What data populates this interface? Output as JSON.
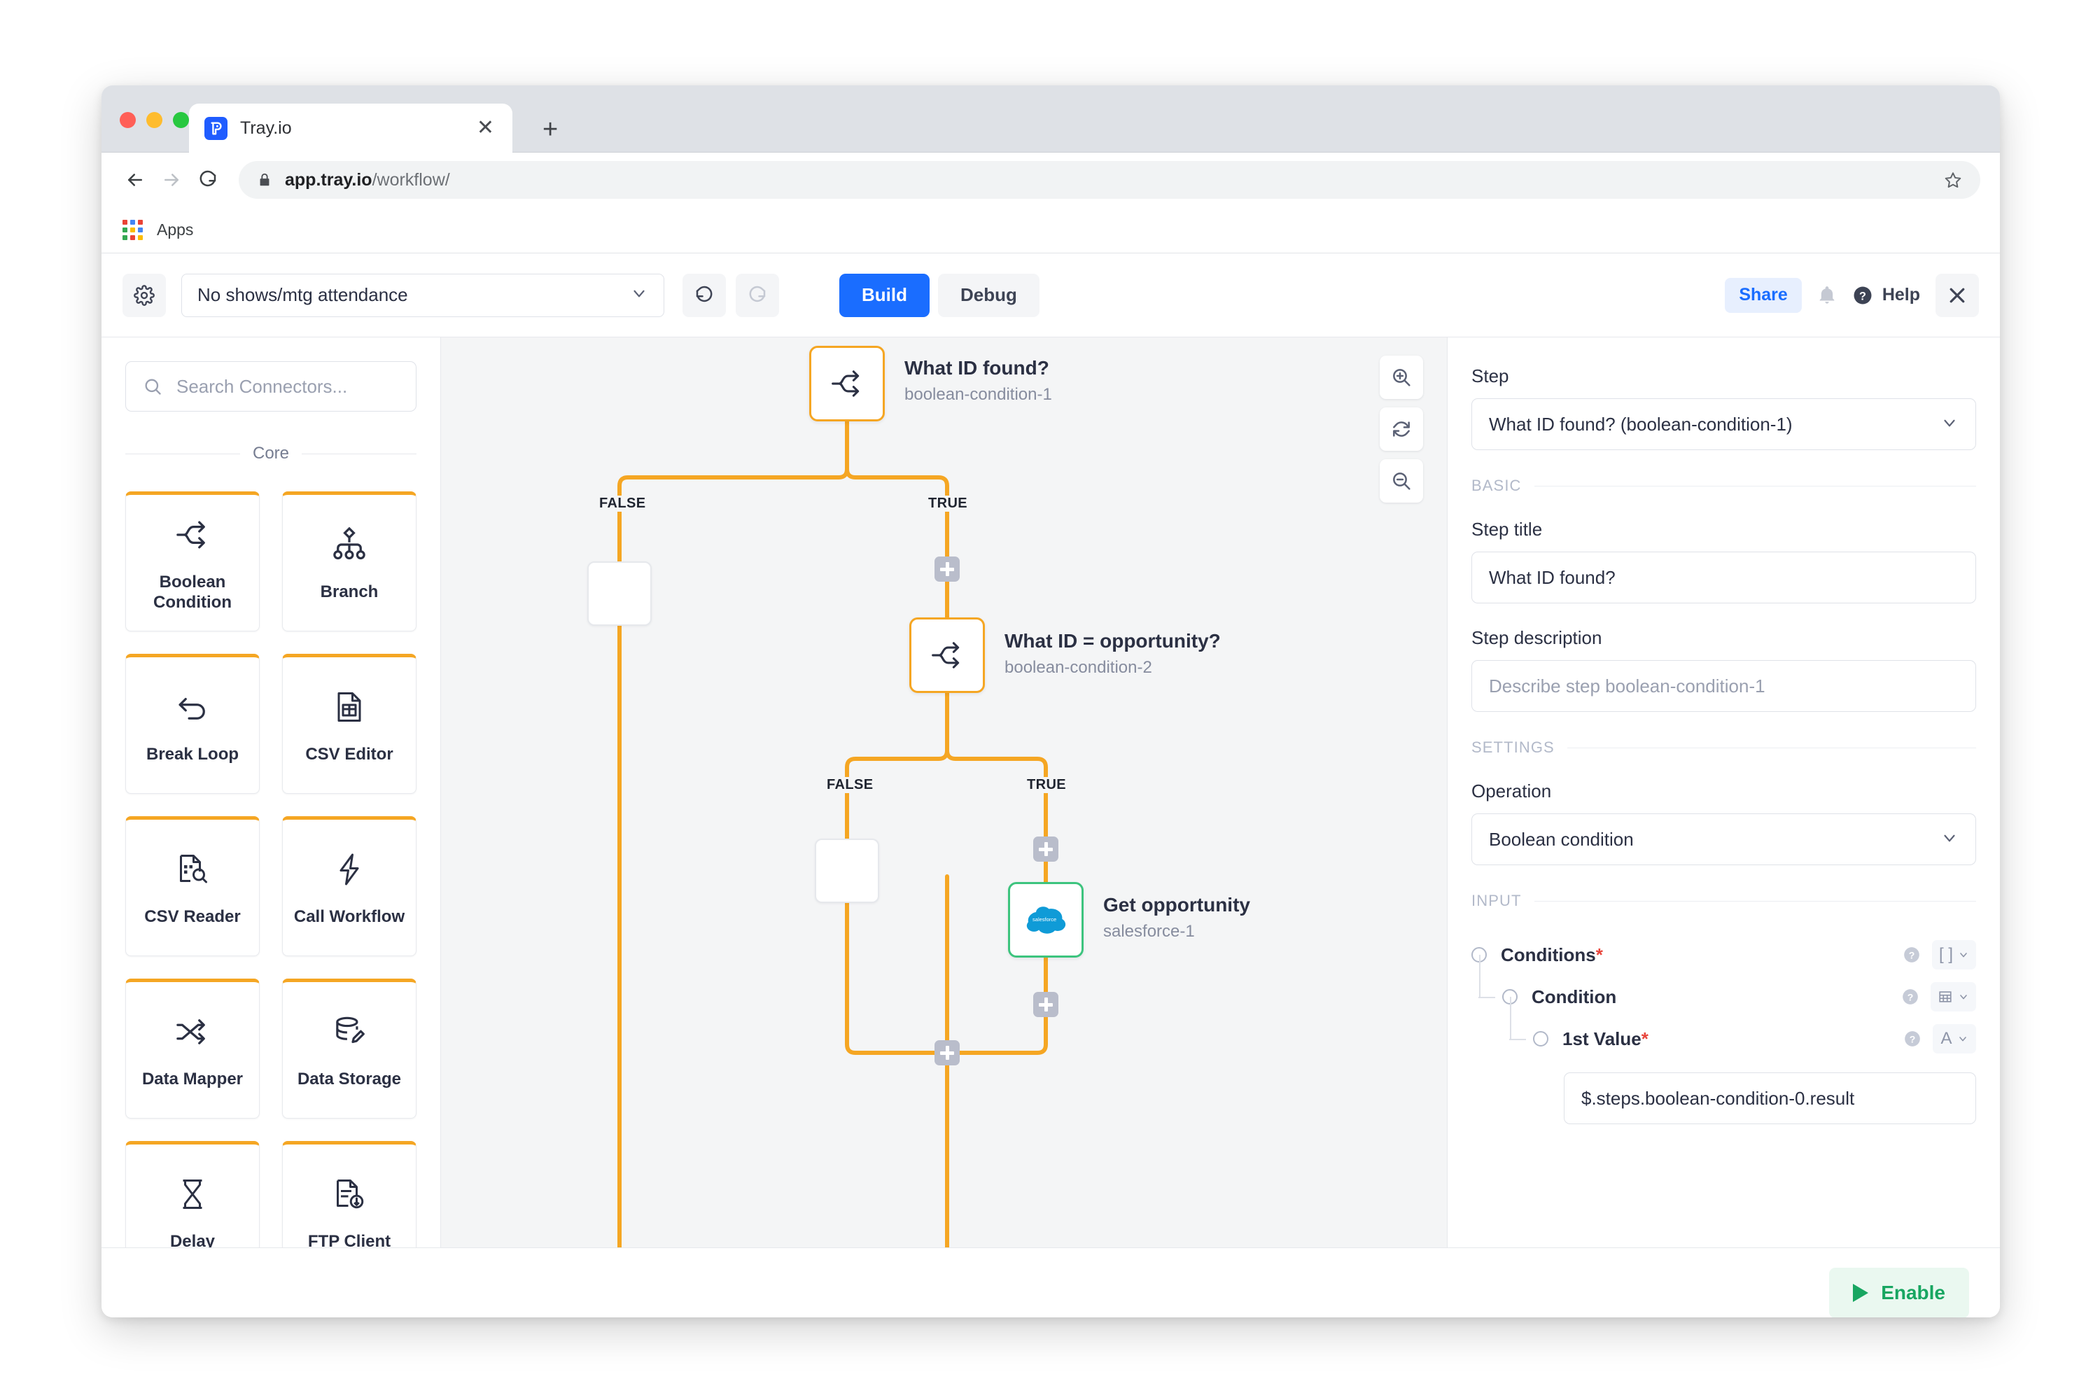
{
  "browser": {
    "tab_title": "Tray.io",
    "tab_favicon": "tray-logo-icon",
    "new_tab_label": "+",
    "close_tab_label": "✕",
    "url_host": "app.tray.io",
    "url_path": "/workflow/",
    "bookmark_apps_label": "Apps",
    "back_icon": "back-arrow-icon",
    "forward_icon": "forward-arrow-icon",
    "reload_icon": "reload-icon",
    "lock_icon": "lock-icon",
    "star_icon": "star-icon"
  },
  "toolbar": {
    "settings_icon": "gear-icon",
    "workflow_name": "No shows/mtg attendance",
    "undo_icon": "undo-icon",
    "redo_icon": "redo-icon",
    "build_label": "Build",
    "debug_label": "Debug",
    "share_label": "Share",
    "bell_icon": "bell-icon",
    "help_label": "Help",
    "help_icon": "question-circle-icon",
    "close_label": "✕",
    "accent_blue": "#1a6dff"
  },
  "left_panel": {
    "search_placeholder": "Search Connectors...",
    "search_icon": "search-icon",
    "group_label": "Core",
    "connectors": [
      {
        "label": "Boolean Condition",
        "icon": "boolean-condition-icon"
      },
      {
        "label": "Branch",
        "icon": "branch-icon"
      },
      {
        "label": "Break Loop",
        "icon": "break-loop-icon"
      },
      {
        "label": "CSV Editor",
        "icon": "csv-editor-icon"
      },
      {
        "label": "CSV Reader",
        "icon": "csv-reader-icon"
      },
      {
        "label": "Call Workflow",
        "icon": "call-workflow-icon"
      },
      {
        "label": "Data Mapper",
        "icon": "data-mapper-icon"
      },
      {
        "label": "Data Storage",
        "icon": "data-storage-icon"
      },
      {
        "label": "Delay",
        "icon": "delay-icon"
      },
      {
        "label": "FTP Client",
        "icon": "ftp-client-icon"
      }
    ],
    "card_accent": "#f5a623"
  },
  "canvas": {
    "zoom_in_icon": "zoom-in-icon",
    "fit_icon": "refresh-fit-icon",
    "zoom_out_icon": "zoom-out-icon",
    "connector_color": "#f5a623",
    "nodes": [
      {
        "title": "What ID found?",
        "subtitle": "boolean-condition-1",
        "icon": "boolean-condition-icon",
        "status": "selected"
      },
      {
        "title": "What ID = opportunity?",
        "subtitle": "boolean-condition-2",
        "icon": "boolean-condition-icon",
        "status": "selected"
      },
      {
        "title": "Get opportunity",
        "subtitle": "salesforce-1",
        "icon": "salesforce-icon",
        "status": "ok"
      }
    ],
    "edge_labels": {
      "branch1_false": "FALSE",
      "branch1_true": "TRUE",
      "branch2_false": "FALSE",
      "branch2_true": "TRUE"
    },
    "add_step_label": "+"
  },
  "right_panel": {
    "step_label": "Step",
    "step_selected": "What ID found? (boolean-condition-1)",
    "basic_section": "BASIC",
    "step_title_label": "Step title",
    "step_title_value": "What ID found?",
    "step_description_label": "Step description",
    "step_description_placeholder": "Describe step boolean-condition-1",
    "settings_section": "SETTINGS",
    "operation_label": "Operation",
    "operation_value": "Boolean condition",
    "input_section": "INPUT",
    "tree": [
      {
        "name": "Conditions",
        "required": true,
        "type_chip": "[ ]",
        "help_icon": "question-circle-icon",
        "depth": 0
      },
      {
        "name": "Condition",
        "required": false,
        "type_chip": "table",
        "help_icon": "question-circle-icon",
        "depth": 1
      },
      {
        "name": "1st Value",
        "required": true,
        "type_chip": "A",
        "help_icon": "question-circle-icon",
        "depth": 2
      }
    ],
    "first_value": "$.steps.boolean-condition-0.result",
    "required_marker": "*"
  },
  "footer": {
    "enable_label": "Enable",
    "enable_icon": "play-icon",
    "enable_color": "#18a661"
  }
}
